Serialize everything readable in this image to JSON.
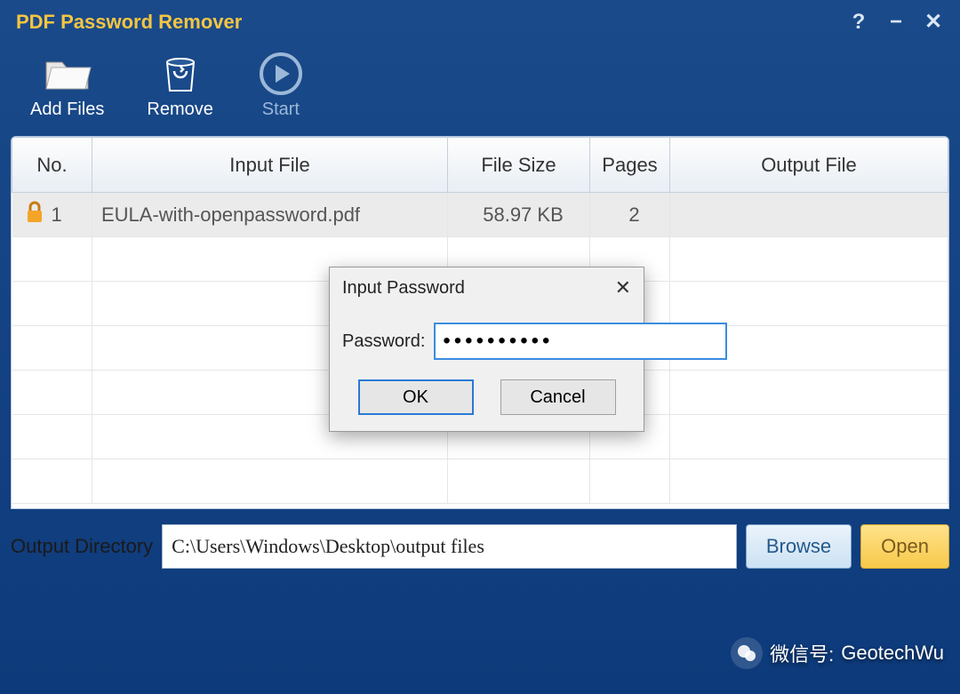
{
  "app_title": "PDF Password Remover",
  "toolbar": {
    "add_files": "Add Files",
    "remove": "Remove",
    "start": "Start"
  },
  "table": {
    "headers": {
      "no": "No.",
      "input": "Input File",
      "size": "File Size",
      "pages": "Pages",
      "output": "Output File"
    },
    "rows": [
      {
        "no": "1",
        "input": "EULA-with-openpassword.pdf",
        "size": "58.97 KB",
        "pages": "2",
        "output": ""
      }
    ]
  },
  "output": {
    "label": "Output Directory",
    "path": "C:\\Users\\Windows\\Desktop\\output files",
    "browse": "Browse",
    "open": "Open"
  },
  "dialog": {
    "title": "Input Password",
    "label": "Password:",
    "value": "••••••••••",
    "ok": "OK",
    "cancel": "Cancel"
  },
  "watermark": {
    "label": "微信号:",
    "id": "GeotechWu"
  }
}
